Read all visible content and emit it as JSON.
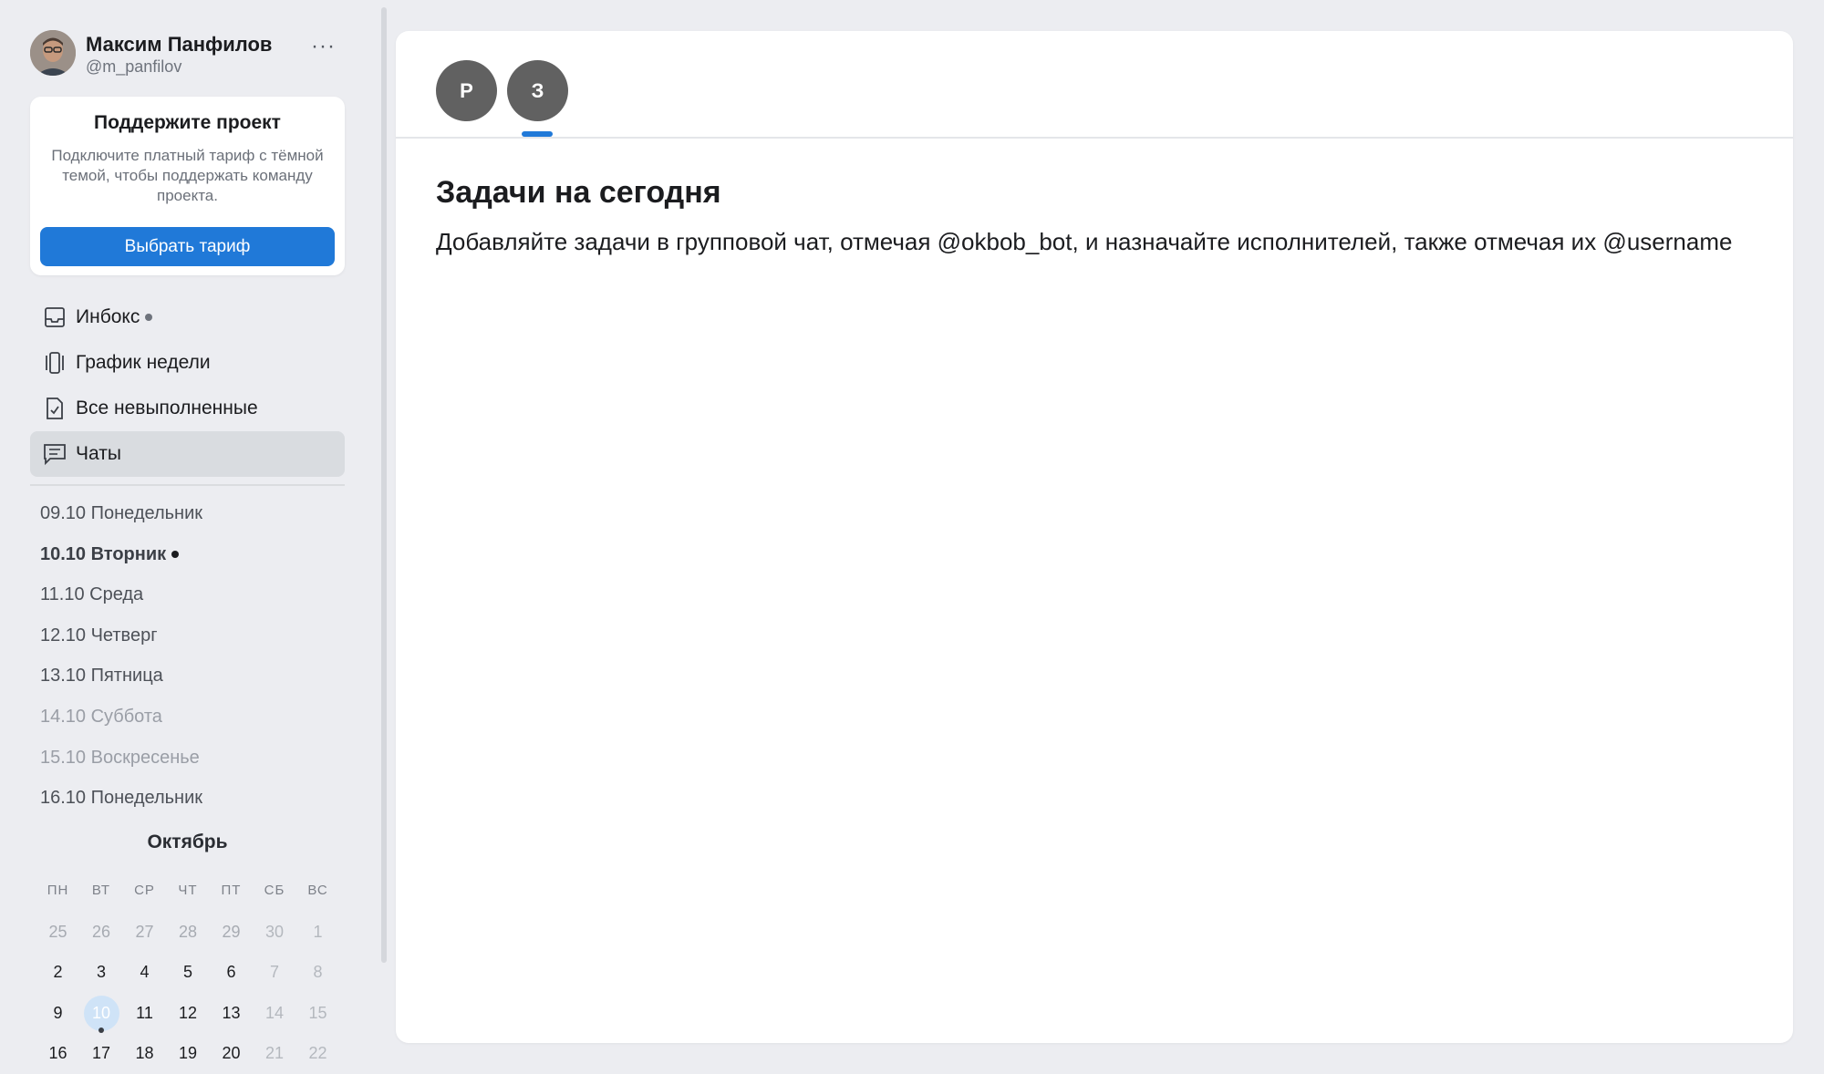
{
  "user": {
    "name": "Максим Панфилов",
    "handle": "@m_panfilov",
    "more": "···"
  },
  "promo": {
    "title": "Поддержите проект",
    "text": "Подключите платный тариф с тёмной темой, чтобы поддержать команду проекта.",
    "button": "Выбрать тариф"
  },
  "nav": [
    {
      "label": "Инбокс",
      "icon": "inbox-icon",
      "dot": true
    },
    {
      "label": "График недели",
      "icon": "week-schedule-icon"
    },
    {
      "label": "Все невыполненные",
      "icon": "checklist-icon"
    },
    {
      "label": "Чаты",
      "icon": "chat-icon",
      "active": true
    }
  ],
  "days": [
    {
      "label": "09.10 Понедельник"
    },
    {
      "label": "10.10 Вторник",
      "current": true
    },
    {
      "label": "11.10 Среда"
    },
    {
      "label": "12.10 Четверг"
    },
    {
      "label": "13.10 Пятница"
    },
    {
      "label": "14.10 Суббота",
      "weekend": true
    },
    {
      "label": "15.10 Воскресенье",
      "weekend": true
    },
    {
      "label": "16.10 Понедельник"
    }
  ],
  "calendar": {
    "month": "Октябрь",
    "weekdays": [
      "ПН",
      "ВТ",
      "СР",
      "ЧТ",
      "ПТ",
      "СБ",
      "ВС"
    ],
    "rows": [
      [
        "25",
        "26",
        "27",
        "28",
        "29",
        "30",
        "1"
      ],
      [
        "2",
        "3",
        "4",
        "5",
        "6",
        "7",
        "8"
      ],
      [
        "9",
        "10",
        "11",
        "12",
        "13",
        "14",
        "15"
      ],
      [
        "16",
        "17",
        "18",
        "19",
        "20",
        "21",
        "22"
      ]
    ],
    "today": "10"
  },
  "tabs": [
    {
      "label": "Р"
    },
    {
      "label": "З",
      "active": true
    }
  ],
  "main": {
    "title": "Задачи на сегодня",
    "text": "Добавляйте задачи в групповой чат, отмечая @okbob_bot, и назначайте исполнителей, также отмечая их @username"
  },
  "colors": {
    "accent": "#2079d8",
    "tab_circle": "#616161",
    "today_bg": "#cfe3f7"
  }
}
